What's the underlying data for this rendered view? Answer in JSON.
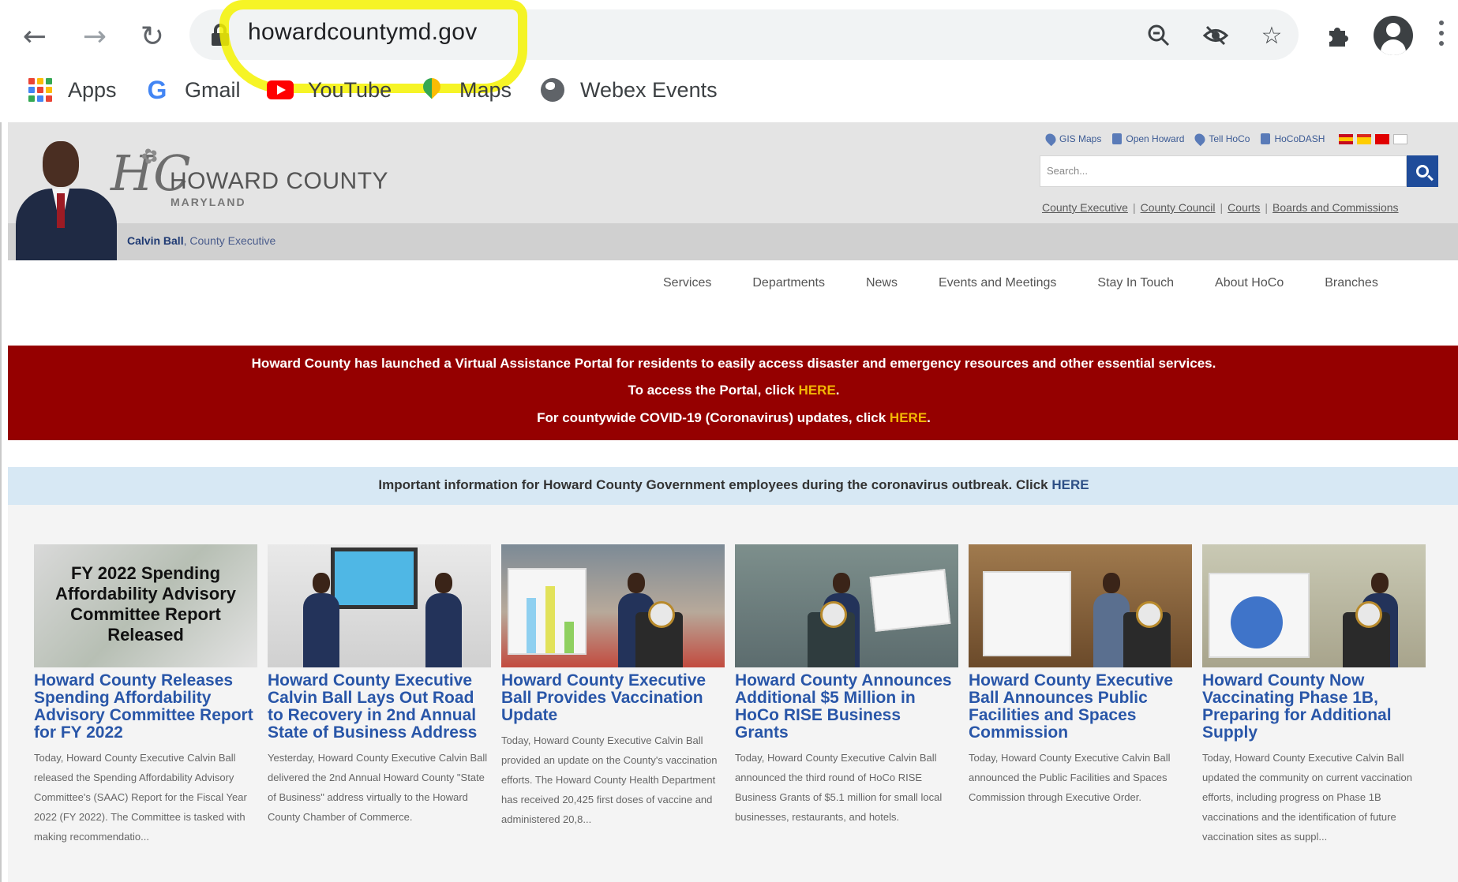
{
  "browser": {
    "url": "howardcountymd.gov",
    "bookmarks": [
      {
        "label": "Apps"
      },
      {
        "label": "Gmail"
      },
      {
        "label": "YouTube"
      },
      {
        "label": "Maps"
      },
      {
        "label": "Webex Events"
      }
    ]
  },
  "header": {
    "county_name": "HOWARD COUNTY",
    "county_sub": "MARYLAND",
    "exec_name": "Calvin Ball",
    "exec_title": ", County Executive",
    "quick_links": [
      "GIS Maps",
      "Open Howard",
      "Tell HoCo",
      "HoCoDASH"
    ],
    "search_placeholder": "Search...",
    "gov_links": [
      "County Executive",
      "County Council",
      "Courts",
      "Boards and Commissions"
    ]
  },
  "nav": [
    "Services",
    "Departments",
    "News",
    "Events and Meetings",
    "Stay In Touch",
    "About HoCo",
    "Branches"
  ],
  "alert": {
    "line1": "Howard County has launched a Virtual Assistance Portal for residents to easily access disaster and emergency resources and other essential services.",
    "line2_pre": "To access the Portal, click ",
    "line2_link": "HERE",
    "line2_post": ".",
    "line3_pre": "For countywide COVID-19 (Coronavirus) updates, click ",
    "line3_link": "HERE",
    "line3_post": "."
  },
  "notice": {
    "text": "Important information for Howard County Government employees during the coronavirus outbreak. Click ",
    "link": "HERE"
  },
  "news": [
    {
      "thumb_text": "FY 2022 Spending Affordability Advisory Committee Report Released",
      "title": "Howard County Releases Spending Affordability Advisory Committee Report for FY 2022",
      "desc": "Today, Howard County Executive Calvin Ball released the Spending Affordability Advisory Committee's (SAAC) Report for the Fiscal Year 2022 (FY 2022). The Committee is tasked with making recommendatio..."
    },
    {
      "title": "Howard County Executive Calvin Ball Lays Out Road to Recovery in 2nd Annual State of Business Address",
      "desc": "Yesterday, Howard County Executive Calvin Ball delivered the 2nd Annual Howard County \"State of Business\" address virtually to the Howard County Chamber of Commerce."
    },
    {
      "title": "Howard County Executive Ball Provides Vaccination Update",
      "desc": "Today, Howard County Executive Calvin Ball provided an update on the County's vaccination efforts. The Howard County Health Department has received 20,425 first doses of vaccine and administered 20,8..."
    },
    {
      "title": "Howard County Announces Additional $5 Million in HoCo RISE Business Grants",
      "desc": "Today, Howard County Executive Calvin Ball announced the third round of HoCo RISE Business Grants of $5.1 million for small local businesses, restaurants, and hotels."
    },
    {
      "title": "Howard County Executive Ball Announces Public Facilities and Spaces Commission",
      "desc": "Today, Howard County Executive Calvin Ball announced the Public Facilities and Spaces Commission through Executive Order."
    },
    {
      "title": "Howard County Now Vaccinating Phase 1B, Preparing for Additional Supply",
      "desc": "Today, Howard County Executive Calvin Ball updated the community on current vaccination efforts, including progress on Phase 1B vaccinations and the identification of future vaccination sites as suppl..."
    }
  ],
  "colors": {
    "alert_bg": "#950000",
    "alert_link": "#f2b705",
    "notice_bg": "#d7e8f4",
    "title_blue": "#2956a8",
    "highlight": "#f5f200"
  }
}
